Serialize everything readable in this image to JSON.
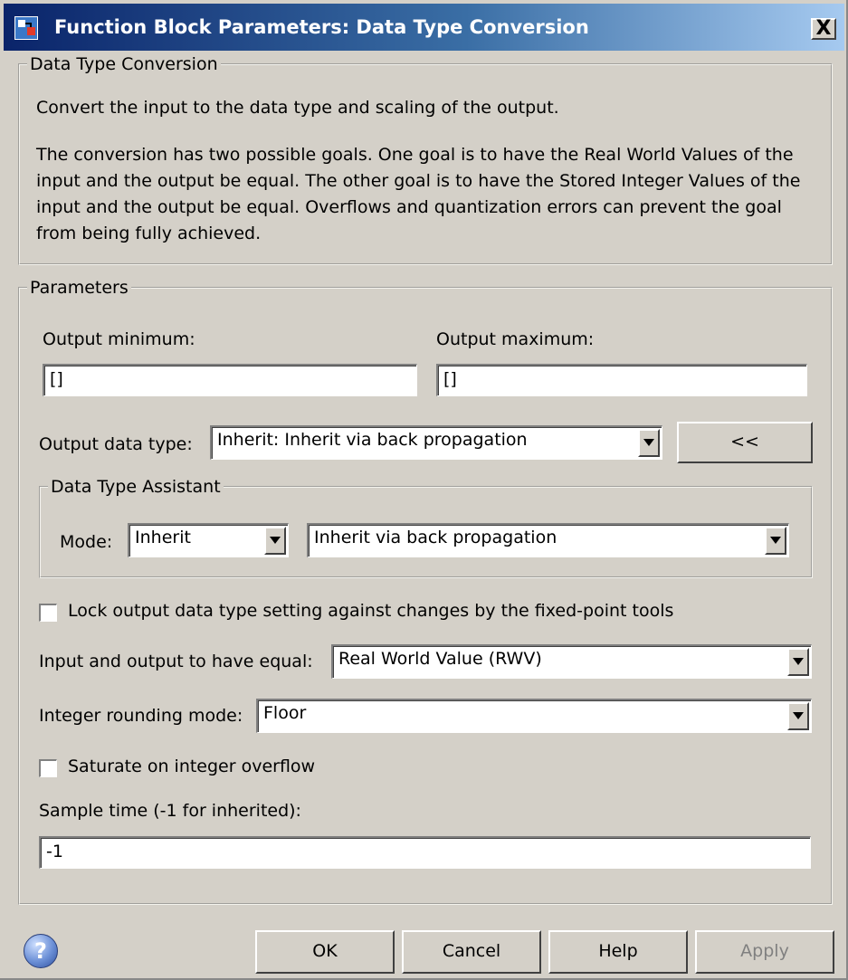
{
  "window": {
    "title": "Function Block Parameters: Data Type Conversion",
    "close_symbol": "X"
  },
  "description": {
    "group_title": "Data Type Conversion",
    "line1": "Convert the input to the data type and scaling of the output.",
    "line2": "The conversion has two possible goals. One goal is to have the Real World Values of the input and the output be equal.  The other goal is to have the Stored Integer Values of the input and the output be equal.  Overflows and quantization errors can prevent the goal from being fully achieved."
  },
  "parameters": {
    "group_title": "Parameters",
    "output_minimum": {
      "label": "Output minimum:",
      "value": "[]"
    },
    "output_maximum": {
      "label": "Output maximum:",
      "value": "[]"
    },
    "output_data_type": {
      "label": "Output data type:",
      "value": "Inherit: Inherit via back propagation",
      "toggle_label": "<<"
    },
    "assistant": {
      "group_title": "Data Type Assistant",
      "mode_label": "Mode:",
      "mode_value": "Inherit",
      "inherit_value": "Inherit via back propagation"
    },
    "lock_checkbox": {
      "label": "Lock output data type setting against changes by the fixed-point tools",
      "checked": false
    },
    "equal": {
      "label": "Input and output to have equal:",
      "value": "Real World Value (RWV)"
    },
    "rounding": {
      "label": "Integer rounding mode:",
      "value": "Floor"
    },
    "saturate_checkbox": {
      "label": "Saturate on integer overflow",
      "checked": false
    },
    "sample_time": {
      "label": "Sample time (-1 for inherited):",
      "value": "-1"
    }
  },
  "footer": {
    "help_icon": "question-mark-icon",
    "help_glyph": "?",
    "ok": "OK",
    "cancel": "Cancel",
    "help": "Help",
    "apply": "Apply"
  },
  "colors": {
    "dialog_bg": "#d4d0c8",
    "titlebar_start": "#0a246a",
    "titlebar_end": "#a6caf0",
    "disabled_text": "#808080"
  }
}
